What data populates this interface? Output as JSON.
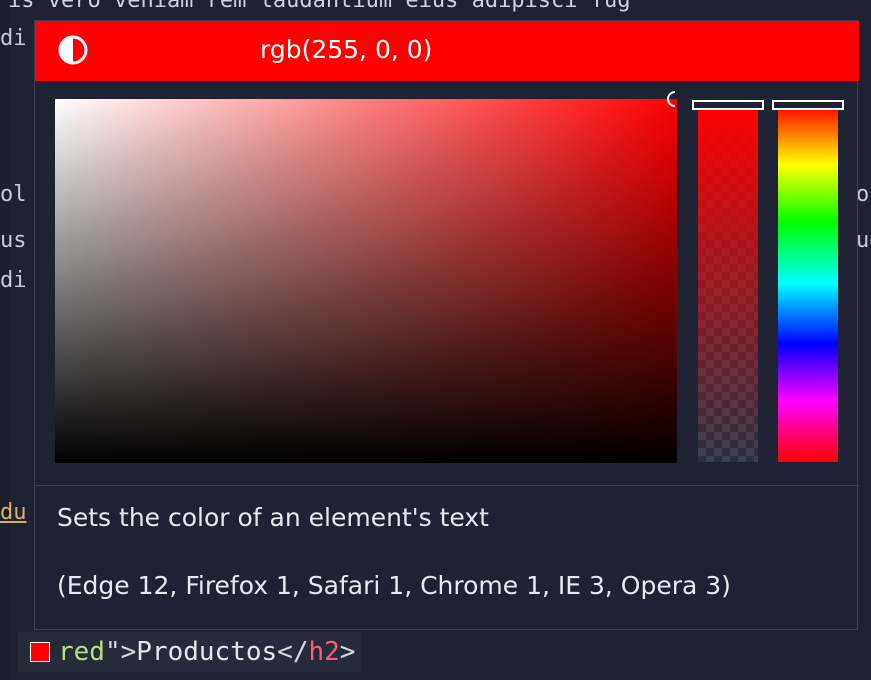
{
  "editor": {
    "top_line": "is vero veniam rem laudantium eius adipisci fug",
    "left_fragments": [
      "di",
      "ol",
      "us",
      "di",
      "du"
    ],
    "right_fragments": [
      "or",
      "ug"
    ],
    "bottom_line": {
      "value": "red",
      "quote": "\">",
      "text": "Productos",
      "close_open": "</",
      "tag": "h2",
      "close_end": ">"
    }
  },
  "color_picker": {
    "color_value": "rgb(255, 0, 0)",
    "current_color": "#ff0000",
    "icons": {
      "mode_toggle": "contrast-icon"
    },
    "description": "Sets the color of an element's text",
    "compatibility": "(Edge 12, Firefox 1, Safari 1, Chrome 1, IE 3, Opera 3)",
    "hue_level": 0,
    "opacity_level": 1
  }
}
